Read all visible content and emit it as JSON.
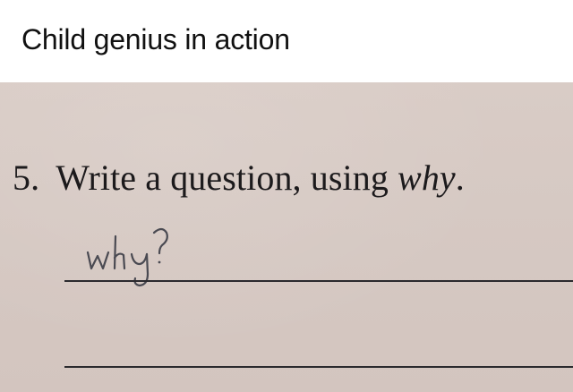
{
  "caption": "Child genius in action",
  "worksheet": {
    "question_number": "5.",
    "question_text": "Write a question, using ",
    "question_keyword": "why",
    "question_end": ".",
    "handwritten_answer": "Why?"
  },
  "colors": {
    "paper": "#d6c9c3",
    "ink_print": "#1c1a1c",
    "ink_pencil": "#4a4a52"
  }
}
